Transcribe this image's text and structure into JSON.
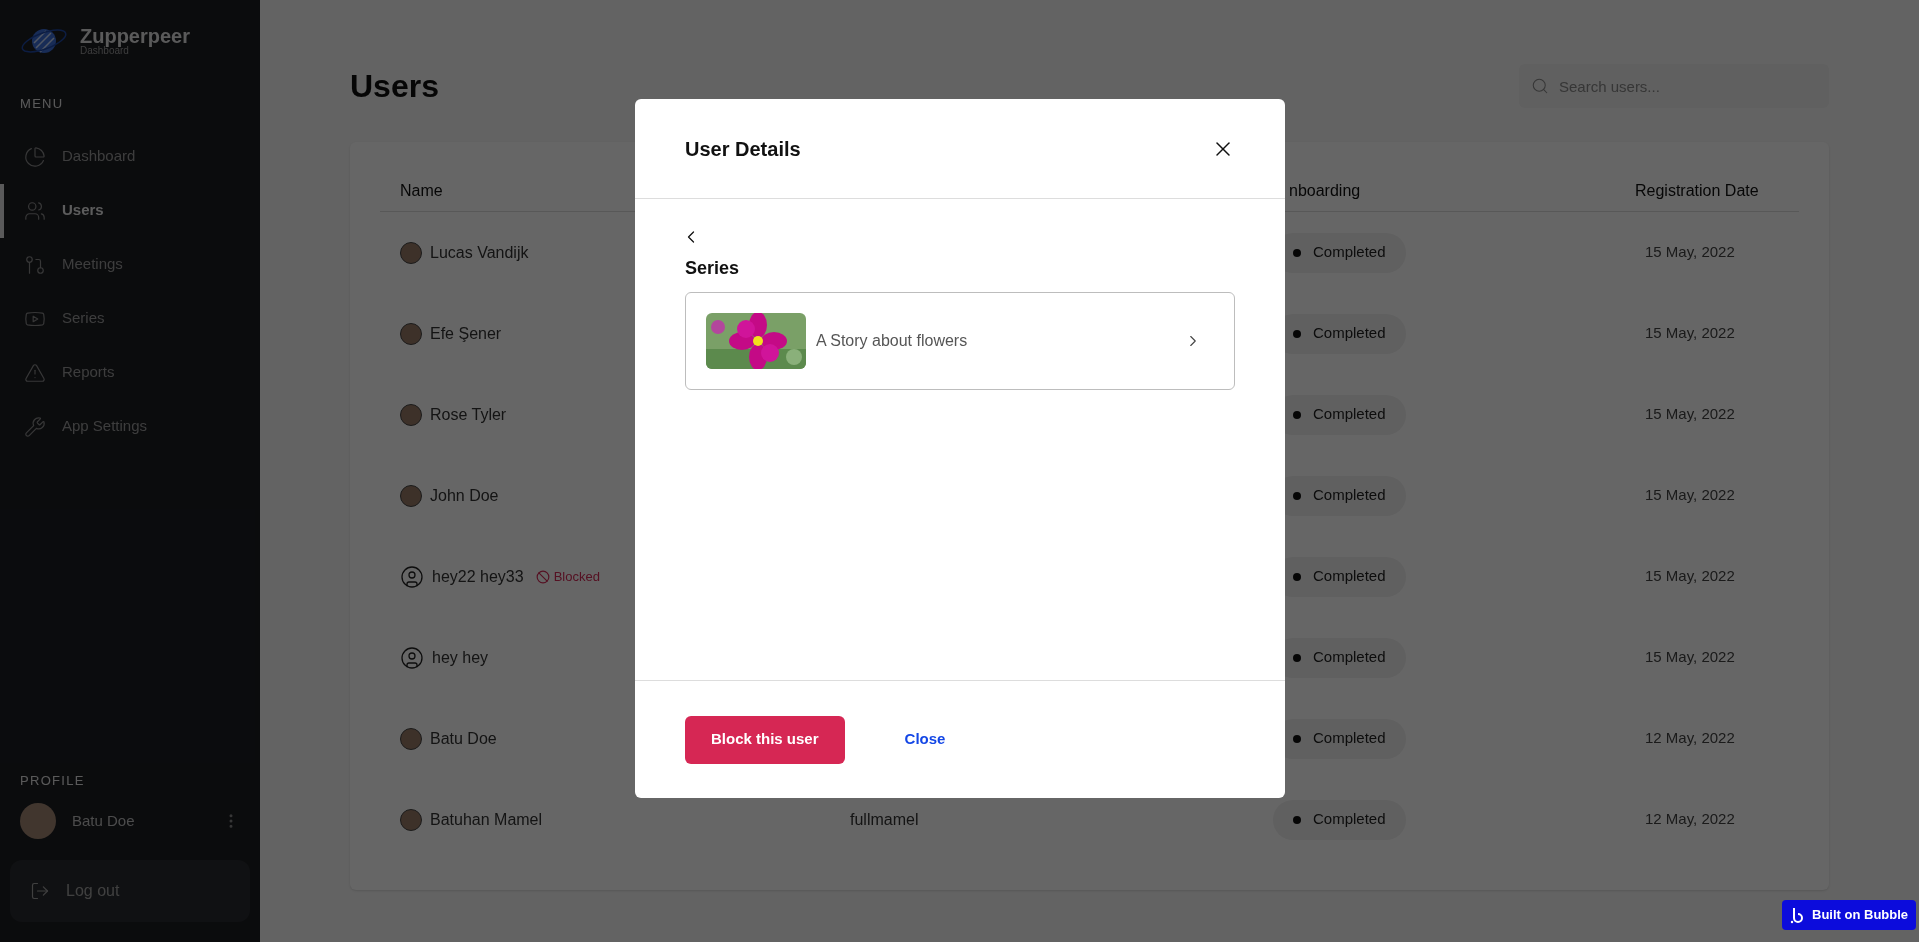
{
  "sidebar": {
    "brand": {
      "name": "Zupperpeer",
      "subtitle": "Dashboard"
    },
    "menu_label": "MENU",
    "items": [
      {
        "label": "Dashboard",
        "selected": false
      },
      {
        "label": "Users",
        "selected": true
      },
      {
        "label": "Meetings",
        "selected": false
      },
      {
        "label": "Series",
        "selected": false
      },
      {
        "label": "Reports",
        "selected": false
      },
      {
        "label": "App Settings",
        "selected": false
      }
    ],
    "profile_label": "PROFILE",
    "profile": {
      "name": "Batu Doe"
    },
    "logout": "Log out"
  },
  "page": {
    "title": "Users",
    "search": {
      "placeholder": "Search users..."
    }
  },
  "table": {
    "columns": [
      "Name",
      "nboarding",
      "Registration Date"
    ],
    "rows": [
      {
        "name": "Lucas Vandijk",
        "onboarding": "Completed",
        "date": "15 May, 2022"
      },
      {
        "name": "Efe Şener",
        "onboarding": "Completed",
        "date": "15 May, 2022"
      },
      {
        "name": "Rose Tyler",
        "onboarding": "Completed",
        "date": "15 May, 2022"
      },
      {
        "name": "John Doe",
        "onboarding": "Completed",
        "date": "15 May, 2022"
      },
      {
        "name": "hey22 hey33",
        "kind": "placeholder",
        "badge": "Blocked",
        "onboarding": "Completed",
        "date": "15 May, 2022"
      },
      {
        "name": "hey hey",
        "kind": "placeholder",
        "onboarding": "Completed",
        "date": "15 May, 2022"
      },
      {
        "name": "Batu Doe",
        "onboarding": "Completed",
        "date": "12 May, 2022"
      },
      {
        "name": "Batuhan Mamel",
        "username": "fullmamel",
        "onboarding": "Completed",
        "date": "12 May, 2022"
      }
    ]
  },
  "modal": {
    "title": "User Details",
    "section": "Series",
    "series": [
      {
        "title": "A Story about flowers",
        "kind": "picture"
      }
    ],
    "buttons": [
      {
        "label": "Block this user",
        "kind": "danger"
      },
      {
        "label": "Close",
        "kind": "link"
      }
    ]
  },
  "footer_badge": "Built on Bubble"
}
